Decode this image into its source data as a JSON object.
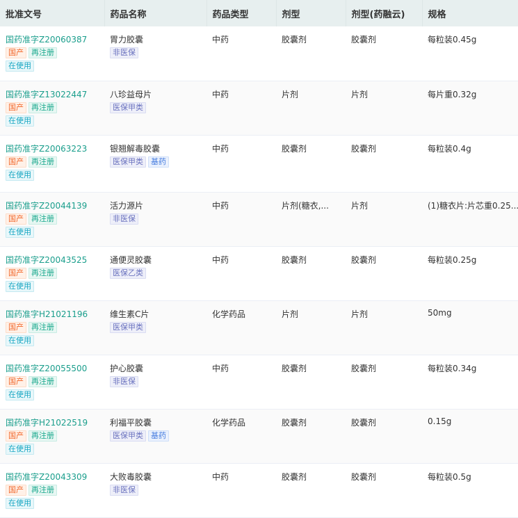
{
  "headers": [
    "批准文号",
    "药品名称",
    "药品类型",
    "剂型",
    "剂型(药融云)",
    "规格"
  ],
  "rows": [
    {
      "approval": "国药准字Z20060387",
      "origin": "国产",
      "reg": "再注册",
      "status": "在使用",
      "name": "胃力胶囊",
      "tags": [
        "非医保"
      ],
      "type": "中药",
      "form": "胶囊剂",
      "form2": "胶囊剂",
      "spec": "每粒装0.45g"
    },
    {
      "approval": "国药准字Z13022447",
      "origin": "国产",
      "reg": "再注册",
      "status": "在使用",
      "name": "八珍益母片",
      "tags": [
        "医保甲类"
      ],
      "type": "中药",
      "form": "片剂",
      "form2": "片剂",
      "spec": "每片重0.32g"
    },
    {
      "approval": "国药准字Z20063223",
      "origin": "国产",
      "reg": "再注册",
      "status": "在使用",
      "name": "银翘解毒胶囊",
      "tags": [
        "医保甲类",
        "基药"
      ],
      "type": "中药",
      "form": "胶囊剂",
      "form2": "胶囊剂",
      "spec": "每粒装0.4g"
    },
    {
      "approval": "国药准字Z20044139",
      "origin": "国产",
      "reg": "再注册",
      "status": "在使用",
      "name": "活力源片",
      "tags": [
        "非医保"
      ],
      "type": "中药",
      "form": "片剂(糖衣,...",
      "form2": "片剂",
      "spec": "(1)糖衣片:片芯重0.25..."
    },
    {
      "approval": "国药准字Z20043525",
      "origin": "国产",
      "reg": "再注册",
      "status": "在使用",
      "name": "通便灵胶囊",
      "tags": [
        "医保乙类"
      ],
      "type": "中药",
      "form": "胶囊剂",
      "form2": "胶囊剂",
      "spec": "每粒装0.25g"
    },
    {
      "approval": "国药准字H21021196",
      "origin": "国产",
      "reg": "再注册",
      "status": "在使用",
      "name": "维生素C片",
      "tags": [
        "医保甲类"
      ],
      "type": "化学药品",
      "form": "片剂",
      "form2": "片剂",
      "spec": "50mg"
    },
    {
      "approval": "国药准字Z20055500",
      "origin": "国产",
      "reg": "再注册",
      "status": "在使用",
      "name": "护心胶囊",
      "tags": [
        "非医保"
      ],
      "type": "中药",
      "form": "胶囊剂",
      "form2": "胶囊剂",
      "spec": "每粒装0.34g"
    },
    {
      "approval": "国药准字H21022519",
      "origin": "国产",
      "reg": "再注册",
      "status": "在使用",
      "name": "利福平胶囊",
      "tags": [
        "医保甲类",
        "基药"
      ],
      "type": "化学药品",
      "form": "胶囊剂",
      "form2": "胶囊剂",
      "spec": "0.15g"
    },
    {
      "approval": "国药准字Z20043309",
      "origin": "国产",
      "reg": "再注册",
      "status": "在使用",
      "name": "大败毒胶囊",
      "tags": [
        "非医保"
      ],
      "type": "中药",
      "form": "胶囊剂",
      "form2": "胶囊剂",
      "spec": "每粒装0.5g"
    }
  ]
}
